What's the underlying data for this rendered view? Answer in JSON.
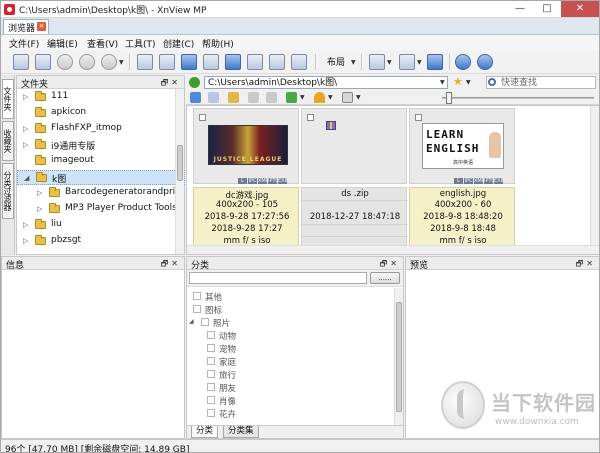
{
  "window": {
    "title": "C:\\Users\\admin\\Desktop\\k图\\ - XnView MP",
    "minimize": "—",
    "maximize": "□",
    "close": "✕"
  },
  "tab": {
    "label": "浏览器",
    "close": "×"
  },
  "menu": [
    "文件(F)",
    "编辑(E)",
    "查看(V)",
    "工具(T)",
    "创建(C)",
    "帮助(H)"
  ],
  "toolbar": {
    "layout_label": "布局"
  },
  "vertical_tabs": [
    "文件夹",
    "收藏夹",
    "分类过滤器"
  ],
  "folder_panel": {
    "title": "文件夹",
    "items": [
      {
        "label": "111",
        "level": 0,
        "expander": "▷"
      },
      {
        "label": "apkicon",
        "level": 0,
        "expander": ""
      },
      {
        "label": "FlashFXP_itmop",
        "level": 0,
        "expander": "▷"
      },
      {
        "label": "i9通用专版",
        "level": 0,
        "expander": "▷"
      },
      {
        "label": "imageout",
        "level": 0,
        "expander": ""
      },
      {
        "label": "k图",
        "level": 0,
        "expander": "◢",
        "selected": true
      },
      {
        "label": "Barcodegeneratorandprin",
        "level": 1,
        "expander": "▷"
      },
      {
        "label": "MP3 Player Product Tools",
        "level": 1,
        "expander": "▷"
      },
      {
        "label": "liu",
        "level": 0,
        "expander": "▷"
      },
      {
        "label": "pbzsgt",
        "level": 0,
        "expander": "▷"
      }
    ]
  },
  "pathbar": {
    "path": "C:\\Users\\admin\\Desktop\\k图\\",
    "search_placeholder": "快速查找"
  },
  "browser": {
    "files": [
      {
        "name": "dc游戏.jpg",
        "dims": "400x200 - 105",
        "created": "2018-9-28 17:27:56",
        "modified": "2018-9-28 17:27",
        "extra": "mm f/ s iso",
        "selected": true,
        "thumb_text": "JUSTICE LEAGUE"
      },
      {
        "name": "ds .zip",
        "dims": "",
        "created": "2018-12-27 18:47:18",
        "modified": "",
        "extra": "",
        "selected": false,
        "thumb_text": ""
      },
      {
        "name": "english.jpg",
        "dims": "400x200 - 60",
        "created": "2018-9-8 18:48:20",
        "modified": "2018-9-8 18:48",
        "extra": "mm f/ s iso",
        "selected": true,
        "thumb_text": [
          "LEARN",
          "ENGLISH",
          "高中英语"
        ]
      }
    ],
    "badges": [
      "L",
      "IPC",
      "XMP",
      "IPTC",
      "EXIF"
    ]
  },
  "info_panel": {
    "title": "信息"
  },
  "category_panel": {
    "title": "分类",
    "button": "......",
    "items": [
      {
        "label": "其他",
        "level": 0,
        "expander": ""
      },
      {
        "label": "图标",
        "level": 0,
        "expander": ""
      },
      {
        "label": "照片",
        "level": 0,
        "expander": "◢"
      },
      {
        "label": "动物",
        "level": 1,
        "expander": ""
      },
      {
        "label": "宠物",
        "level": 1,
        "expander": ""
      },
      {
        "label": "家庭",
        "level": 1,
        "expander": ""
      },
      {
        "label": "旅行",
        "level": 1,
        "expander": ""
      },
      {
        "label": "朋友",
        "level": 1,
        "expander": ""
      },
      {
        "label": "肖像",
        "level": 1,
        "expander": ""
      },
      {
        "label": "花卉",
        "level": 1,
        "expander": ""
      }
    ],
    "tabs": [
      "分类",
      "分类集"
    ]
  },
  "preview_panel": {
    "title": "预览"
  },
  "watermark": {
    "text": "当下软件园",
    "url": "www.downxia.com"
  },
  "status": {
    "text": "96个 [47.70 MB] [剩余磁盘空间: 14.89 GB]"
  },
  "colors": {
    "selection": "#cde3f7",
    "info_bg": "#f4f0c8",
    "close_btn": "#c75050"
  }
}
